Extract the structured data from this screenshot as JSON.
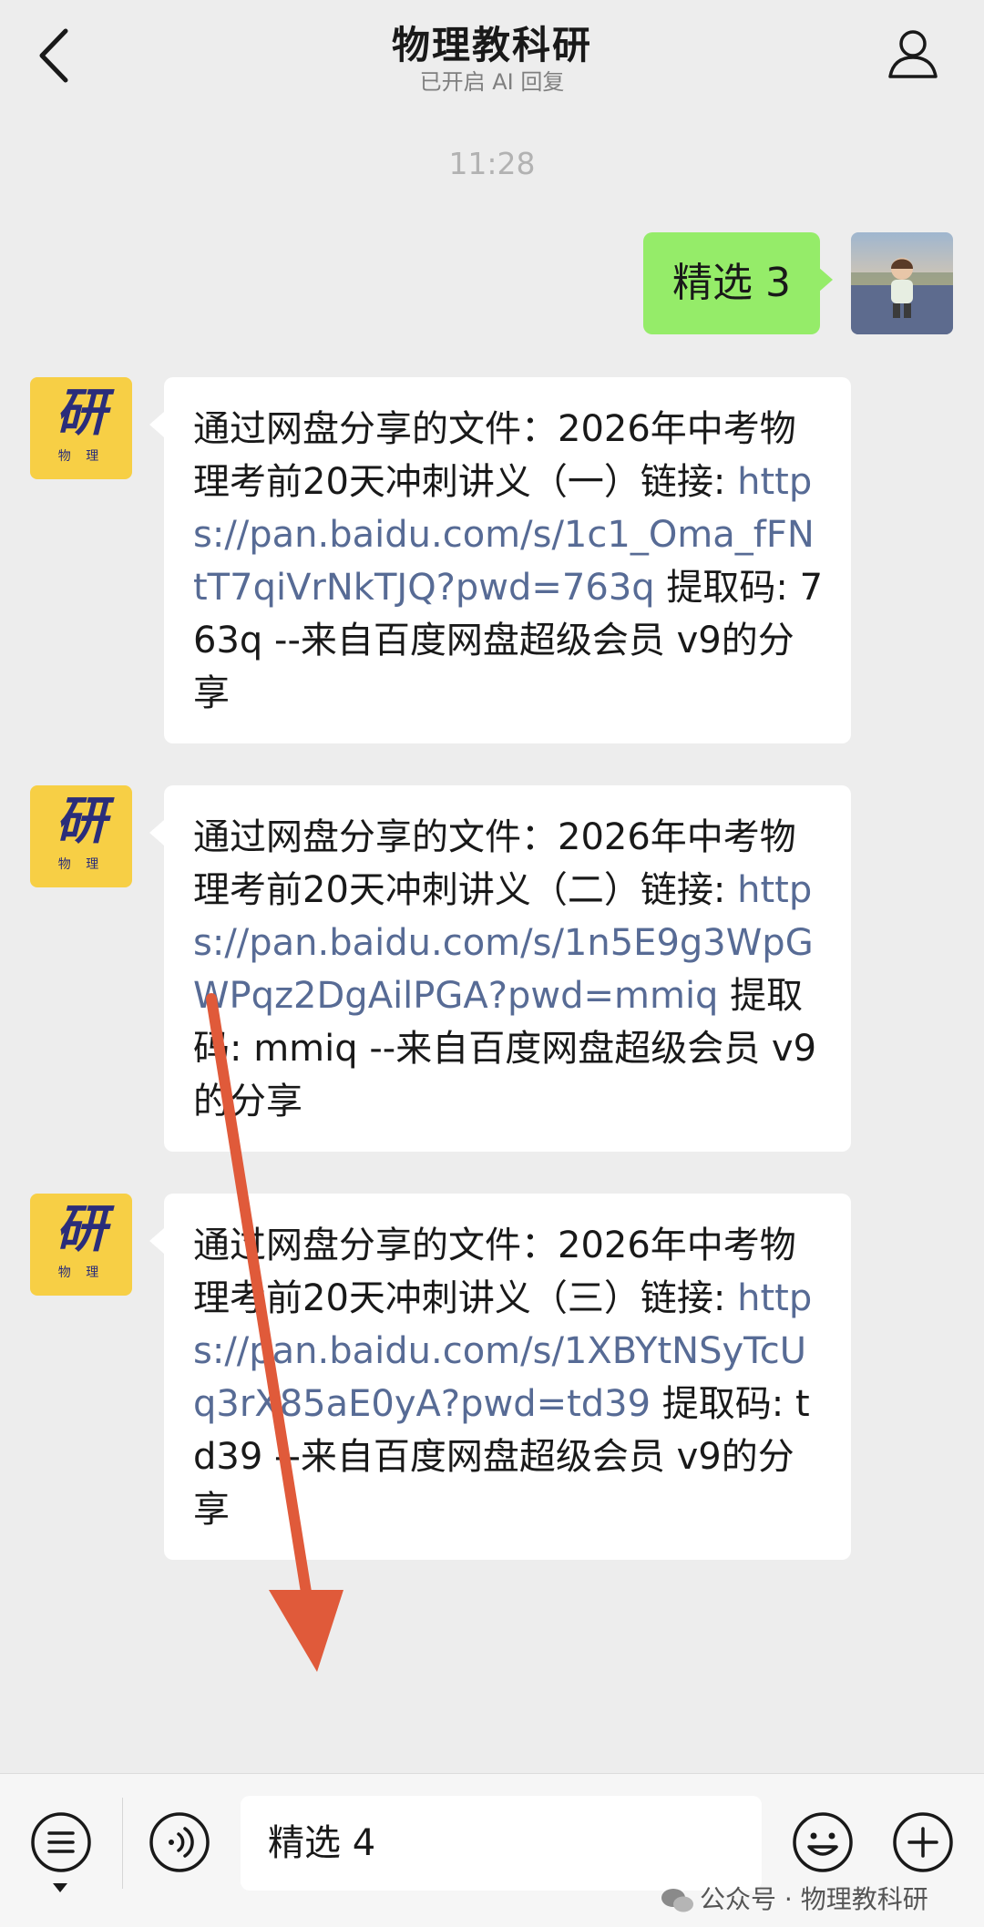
{
  "header": {
    "back_icon": "chevron-left-icon",
    "title": "物理教科研",
    "subtitle": "已开启 AI 回复",
    "profile_icon": "person-icon"
  },
  "chat": {
    "time": "11:28",
    "my_message": "精选 3",
    "bot_avatar": {
      "glyph": "研",
      "sub": "物 理",
      "color": "#f7cf45"
    },
    "messages": [
      {
        "prefix": "通过网盘分享的文件：2026年中考物理考前20天冲刺讲义（一）链接: ",
        "link": "https://pan.baidu.com/s/1c1_Oma_fFNtT7qiVrNkTJQ?pwd=763q",
        "suffix": " 提取码: 763q --来自百度网盘超级会员 v9的分享"
      },
      {
        "prefix": "通过网盘分享的文件：2026年中考物理考前20天冲刺讲义（二）链接: ",
        "link": "https://pan.baidu.com/s/1n5E9g3WpGWPqz2DgAilPGA?pwd=mmiq",
        "suffix": " 提取码: mmiq --来自百度网盘超级会员 v9的分享"
      },
      {
        "prefix": "通过网盘分享的文件：2026年中考物理考前20天冲刺讲义（三）链接: ",
        "link": "https://pan.baidu.com/s/1XBYtNSyTcUq3rX85aE0yA?pwd=td39",
        "suffix": " 提取码: td39 --来自百度网盘超级会员 v9的分享"
      }
    ]
  },
  "composer": {
    "menu_icon": "menu-list-icon",
    "voice_icon": "voice-icon",
    "input_value": "精选 4",
    "emoji_icon": "emoji-icon",
    "plus_icon": "plus-icon"
  },
  "watermark": {
    "text": "公众号 · 物理教科研",
    "icon": "wechat-icon"
  },
  "colors": {
    "background": "#ededed",
    "my_bubble": "#95ec69",
    "link": "#576b95",
    "annotation_arrow": "#e05a3a"
  }
}
